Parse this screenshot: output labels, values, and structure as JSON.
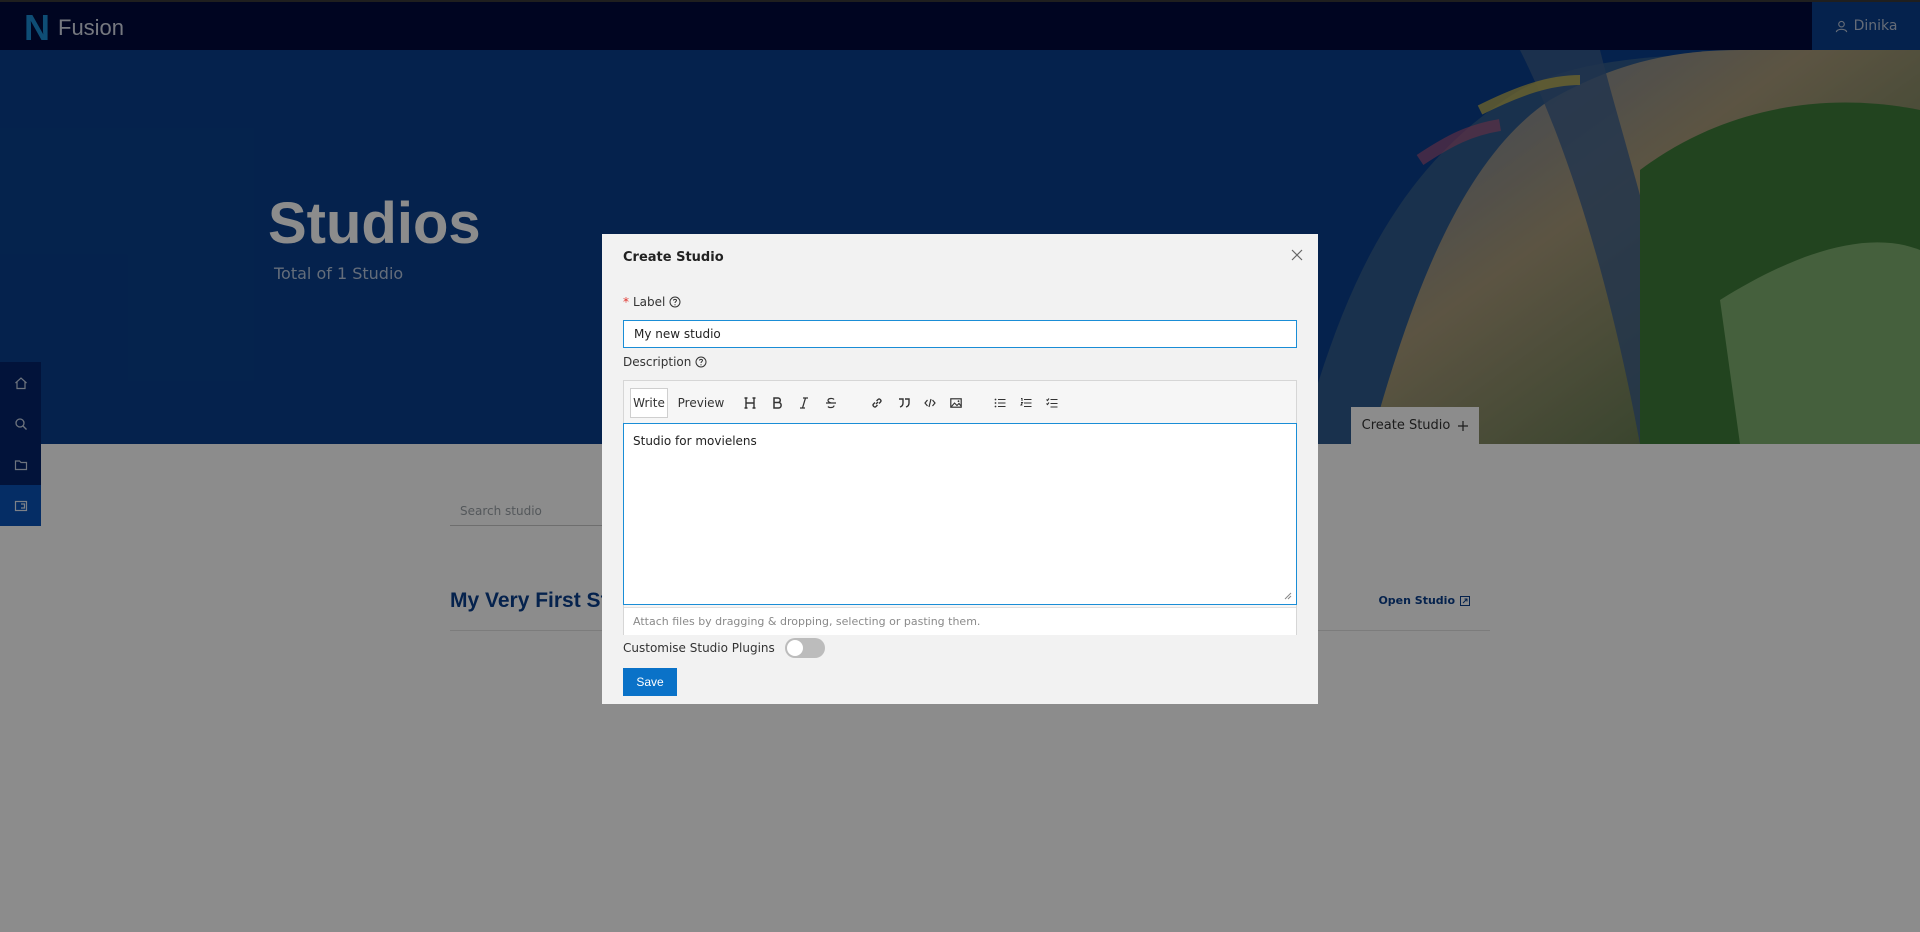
{
  "app": {
    "logo_letter": "N",
    "name": "Fusion"
  },
  "user": {
    "name": "Dinika",
    "icon": "user-icon"
  },
  "hero": {
    "title": "Studios",
    "subtitle": "Total of 1 Studio",
    "create_button": "Create Studio"
  },
  "sidenav": {
    "items": [
      {
        "icon": "home-icon"
      },
      {
        "icon": "search-icon"
      },
      {
        "icon": "folder-icon"
      },
      {
        "icon": "studio-icon",
        "active": true
      }
    ]
  },
  "content": {
    "search_placeholder": "Search studio",
    "studio_name": "My Very First Stu",
    "open_studio": "Open Studio"
  },
  "modal": {
    "title": "Create Studio",
    "label_field": {
      "label": "Label",
      "value": "My new studio"
    },
    "description_field": {
      "label": "Description",
      "tabs": [
        "Write",
        "Preview"
      ],
      "toolbar_icons": [
        "heading-icon",
        "bold-icon",
        "italic-icon",
        "strikethrough-icon",
        "link-icon",
        "quote-icon",
        "code-icon",
        "image-icon",
        "bullet-list-icon",
        "numbered-list-icon",
        "task-list-icon"
      ],
      "value": "Studio for movielens",
      "attach_hint": "Attach files by dragging & dropping, selecting or pasting them."
    },
    "toggle": {
      "label": "Customise Studio Plugins",
      "on": false
    },
    "save_label": "Save"
  },
  "colors": {
    "topbar": "#010a3d",
    "hero": "#0a3f8c",
    "accent": "#1a8dd6",
    "save": "#0a72c8"
  }
}
